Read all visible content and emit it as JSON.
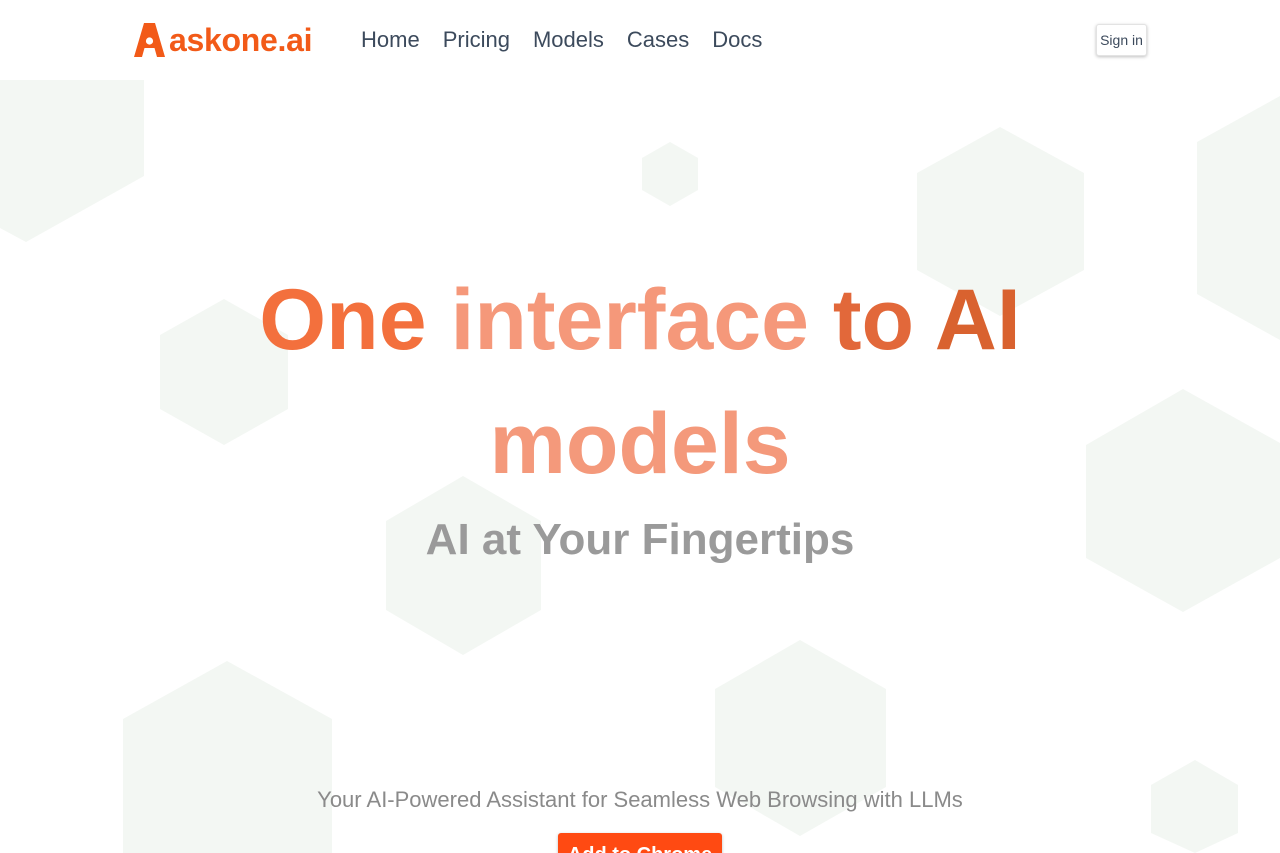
{
  "brand": {
    "name": "askone.ai",
    "logo_icon": "letter-a-logo-icon",
    "color": "#f25a18"
  },
  "nav": {
    "items": [
      {
        "label": "Home"
      },
      {
        "label": "Pricing"
      },
      {
        "label": "Models"
      },
      {
        "label": "Cases"
      },
      {
        "label": "Docs"
      }
    ],
    "signin_label": "Sign in"
  },
  "hero": {
    "headline_words": [
      "One",
      "interface",
      "to",
      "AI",
      "models"
    ],
    "subheadline": "AI at Your Fingertips",
    "tagline": "Your AI-Powered Assistant for Seamless Web Browsing with LLMs",
    "cta_label": "Add to Chrome"
  },
  "colors": {
    "accent": "#ff4a12",
    "nav_text": "#3c4a5c",
    "hexagon_fill": "#f3f7f3"
  }
}
